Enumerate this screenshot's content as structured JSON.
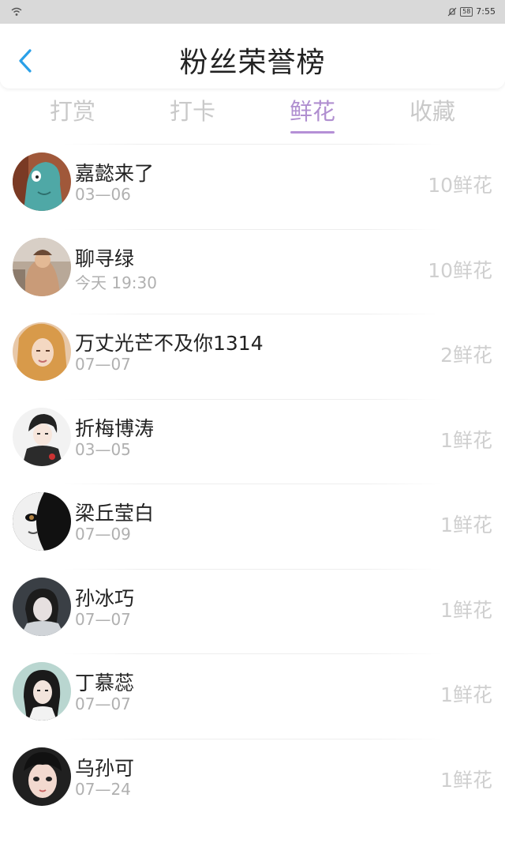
{
  "status_bar": {
    "battery": "58",
    "time": "7:55"
  },
  "header": {
    "title": "粉丝荣誉榜"
  },
  "tabs": [
    {
      "label": "打赏",
      "active": false
    },
    {
      "label": "打卡",
      "active": false
    },
    {
      "label": "鲜花",
      "active": true
    },
    {
      "label": "收藏",
      "active": false
    }
  ],
  "colors": {
    "accent": "#b58fd6",
    "muted_text": "#b0b0b0",
    "amount_text": "#cfcfcf"
  },
  "fans": [
    {
      "name": "嘉懿来了",
      "date": "03—06",
      "amount": "10鲜花"
    },
    {
      "name": "聊寻绿",
      "date": "今天  19:30",
      "amount": "10鲜花"
    },
    {
      "name": "万丈光芒不及你1314",
      "date": "07—07",
      "amount": "2鲜花"
    },
    {
      "name": "折梅博涛",
      "date": "03—05",
      "amount": "1鲜花"
    },
    {
      "name": "梁丘莹白",
      "date": "07—09",
      "amount": "1鲜花"
    },
    {
      "name": "孙冰巧",
      "date": "07—07",
      "amount": "1鲜花"
    },
    {
      "name": "丁慕蕊",
      "date": "07—07",
      "amount": "1鲜花"
    },
    {
      "name": "乌孙可",
      "date": "07—24",
      "amount": "1鲜花"
    }
  ]
}
